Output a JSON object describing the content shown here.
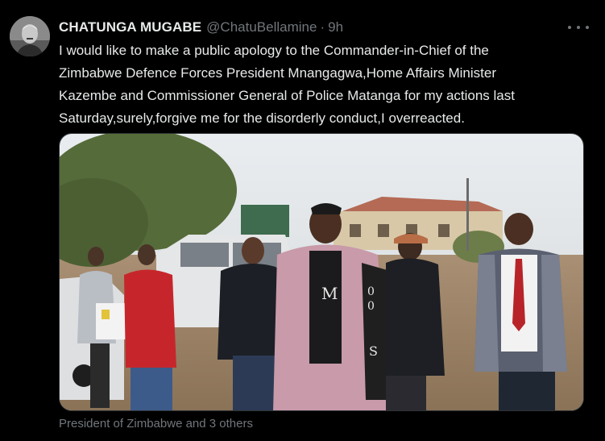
{
  "tweet": {
    "author_name": "CHATUNGA MUGABE",
    "author_handle": "@ChatuBellamine",
    "separator": "·",
    "timestamp": "9h",
    "text": "I would like to make a public apology to the Commander-in-Chief of the\nZimbabwe Defence Forces President Mnangagwa,Home Affairs Minister\nKazembe and Commissioner General of Police  Matanga for my actions last\nSaturday,surely,forgive me for the disorderly conduct,I overreacted.",
    "tagged_people": "President of Zimbabwe and 3 others"
  },
  "icons": {
    "avatar": "profile-photo",
    "more": "more-options-icon"
  },
  "colors": {
    "background": "#000000",
    "text": "#e7e9ea",
    "muted": "#71767b"
  }
}
